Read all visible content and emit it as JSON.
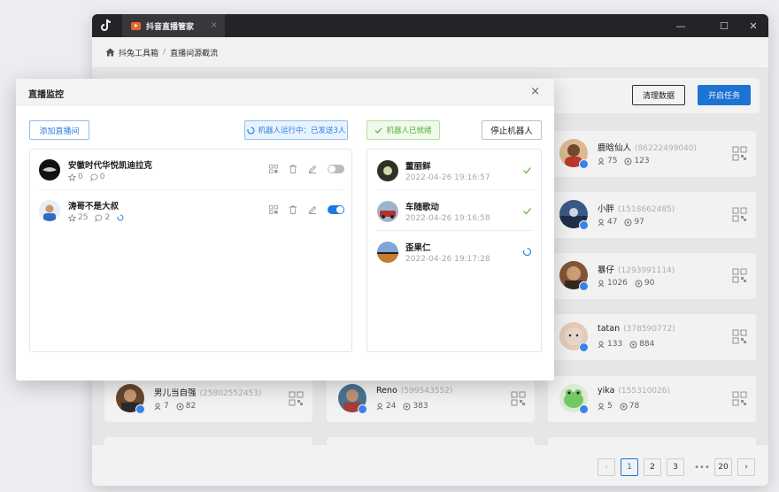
{
  "app": {
    "tab_label": "抖音直播管家",
    "tab_close": "×",
    "window_controls": {
      "minimize": "—",
      "maximize": "☐",
      "close": "✕"
    }
  },
  "breadcrumb": {
    "home": "抖兔工具箱",
    "separator": "/",
    "current": "直播间源截流"
  },
  "toolbar": {
    "clear_label": "清理数据",
    "start_label": "开启任务"
  },
  "users": [
    {
      "name": "鹿晗仙人",
      "id": "(86222499040)",
      "followers": "75",
      "views": "123",
      "avatar_bg": "#e9c39a"
    },
    {
      "name": "小胖",
      "id": "(1518662485)",
      "followers": "47",
      "views": "97",
      "avatar_bg": "#3c5f8f"
    },
    {
      "name": "暴仔",
      "id": "(1293991114)",
      "followers": "1026",
      "views": "90",
      "avatar_bg": "#8a5a3c"
    },
    {
      "name": "tatan",
      "id": "(378590772)",
      "followers": "133",
      "views": "884",
      "avatar_bg": "#f0d6c4"
    },
    {
      "name": "男儿当自强",
      "id": "(25802552453)",
      "followers": "7",
      "views": "82",
      "avatar_bg": "#6b4a32"
    },
    {
      "name": "Reno",
      "id": "(599543552)",
      "followers": "24",
      "views": "383",
      "avatar_bg": "#4d7a9a"
    },
    {
      "name": "yika",
      "id": "(155310026)",
      "followers": "5",
      "views": "78",
      "avatar_bg": "#e8f6e0"
    }
  ],
  "pagination": {
    "prev": "‹",
    "pages": [
      "1",
      "2",
      "3"
    ],
    "ellipsis": "•••",
    "last": "20",
    "next": "›",
    "current": "1"
  },
  "dialog": {
    "title": "直播监控",
    "close": "×",
    "add_room_label": "添加直播间",
    "running_status": "机器人运行中：已发送3人",
    "ready_status": "机器人已就绪",
    "stop_label": "停止机器人",
    "rooms": [
      {
        "name": "安徽时代华悦凯迪拉克",
        "likes": "0",
        "comments": "0",
        "enabled": false
      },
      {
        "name": "涛哥不是大叔",
        "likes": "25",
        "comments": "2",
        "enabled": true
      }
    ],
    "robots": [
      {
        "name": "董丽鲜",
        "time": "2022-04-26 19:16:57",
        "state": "done"
      },
      {
        "name": "车随歌动",
        "time": "2022-04-26 19:16:58",
        "state": "done"
      },
      {
        "name": "歪果仁",
        "time": "2022-04-26 19:17:28",
        "state": "loading"
      }
    ]
  },
  "colors": {
    "accent": "#1f7ae0",
    "success": "#52b23a",
    "titlebar": "#25262b"
  }
}
